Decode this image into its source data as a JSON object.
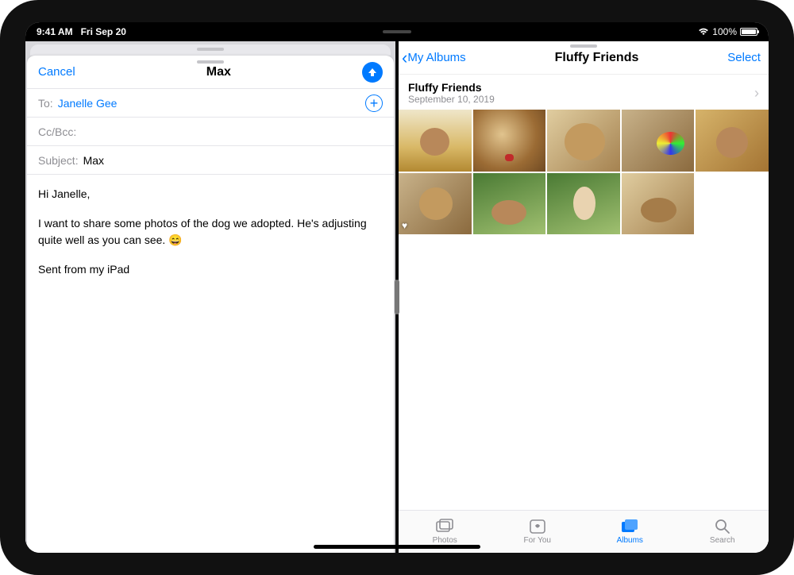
{
  "status": {
    "time": "9:41 AM",
    "date": "Fri Sep 20",
    "battery_pct": "100%"
  },
  "mail": {
    "cancel": "Cancel",
    "title": "Max",
    "to_label": "To:",
    "to_value": "Janelle Gee",
    "cc_label": "Cc/Bcc:",
    "subject_label": "Subject:",
    "subject_value": "Max",
    "body_greeting": "Hi Janelle,",
    "body_para": "I want to share some photos of the dog we adopted. He's adjusting quite well as you can see. 😄",
    "signature": "Sent from my iPad"
  },
  "photos": {
    "back_label": "My Albums",
    "nav_title": "Fluffy Friends",
    "select": "Select",
    "album_name": "Fluffy Friends",
    "album_date": "September 10, 2019",
    "thumbs": [
      {
        "favorite": false
      },
      {
        "favorite": false
      },
      {
        "favorite": false
      },
      {
        "favorite": false
      },
      {
        "favorite": false
      },
      {
        "favorite": true
      },
      {
        "favorite": false
      },
      {
        "favorite": false
      },
      {
        "favorite": false
      }
    ],
    "tabs": {
      "photos": "Photos",
      "for_you": "For You",
      "albums": "Albums",
      "search": "Search"
    }
  }
}
